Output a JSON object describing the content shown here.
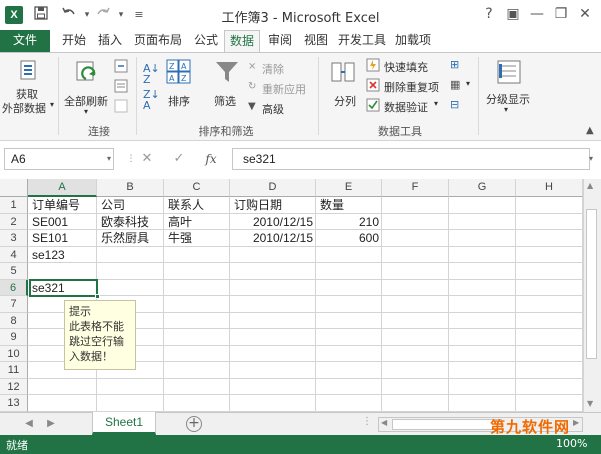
{
  "window": {
    "title": "工作簿3 - Microsoft Excel",
    "help": "?",
    "minimize": "—",
    "restore": "❐",
    "close": "✕"
  },
  "qat": {
    "save_icon": "save-icon",
    "undo_icon": "undo-icon",
    "redo_icon": "redo-icon"
  },
  "tabs": [
    "文件",
    "开始",
    "插入",
    "页面布局",
    "公式",
    "数据",
    "审阅",
    "视图",
    "开发工具",
    "加载项"
  ],
  "active_tab": "数据",
  "ribbon": {
    "get_external_1": "获取",
    "get_external_2": "外部数据",
    "refresh_all": "全部刷新",
    "group_connections": "连接",
    "sort": "排序",
    "filter": "筛选",
    "clear": "清除",
    "reapply": "重新应用",
    "advanced": "高级",
    "group_sort_filter": "排序和筛选",
    "split": "分列",
    "flash_fill": "快速填充",
    "remove_duplicates": "删除重复项",
    "data_validation": "数据验证",
    "group_data_tools": "数据工具",
    "outline": "分级显示"
  },
  "formula_bar": {
    "name_box": "A6",
    "fx": "fx",
    "value": "se321"
  },
  "columns": [
    "A",
    "B",
    "C",
    "D",
    "E",
    "F",
    "G",
    "H"
  ],
  "rows": [
    "1",
    "2",
    "3",
    "4",
    "5",
    "6",
    "7",
    "8",
    "9",
    "10",
    "11",
    "12",
    "13"
  ],
  "cells": {
    "A1": "订单编号",
    "B1": "公司",
    "C1": "联系人",
    "D1": "订购日期",
    "E1": "数量",
    "A2": "SE001",
    "B2": "欧泰科技",
    "C2": "高叶",
    "D2": "2010/12/15",
    "E2": "210",
    "A3": "SE101",
    "B3": "乐然厨具",
    "C3": "牛强",
    "D3": "2010/12/15",
    "E3": "600",
    "A4": "se123",
    "A6": "se321"
  },
  "tooltip": {
    "title": "提示",
    "line1": "此表格不能",
    "line2": "跳过空行输",
    "line3": "入数据！"
  },
  "sheets": [
    "Sheet1"
  ],
  "status": {
    "ready": "就绪",
    "zoom": "100%"
  },
  "watermark": "第九软件网"
}
